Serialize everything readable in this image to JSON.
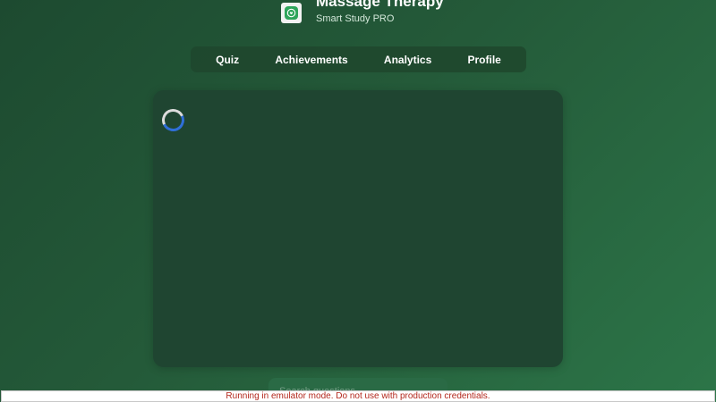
{
  "app": {
    "title": "Massage Therapy",
    "subtitle": "Smart Study PRO",
    "logo_icon": "app-logo-icon",
    "accent_color": "#2ea55b"
  },
  "nav": {
    "tabs": [
      {
        "label": "Quiz"
      },
      {
        "label": "Achievements"
      },
      {
        "label": "Analytics"
      },
      {
        "label": "Profile"
      }
    ]
  },
  "content": {
    "loading_icon": "loading-spinner-icon",
    "spinner_color": "#2f6fd8"
  },
  "search": {
    "placeholder": "Search questions..."
  },
  "banner": {
    "text": "Running in emulator mode. Do not use with production credentials.",
    "text_color": "#b3271c"
  }
}
